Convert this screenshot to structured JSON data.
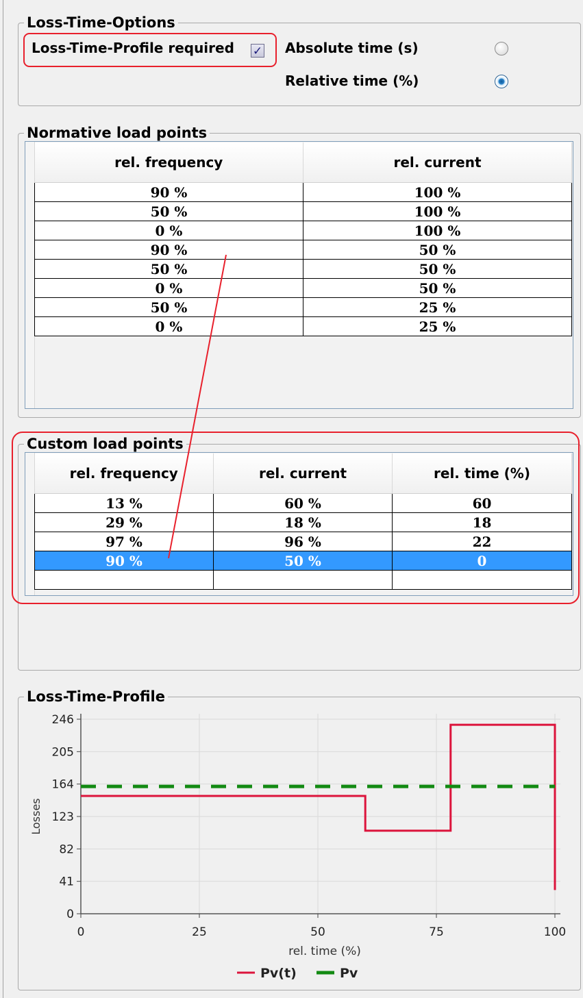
{
  "options": {
    "title": "Loss-Time-Options",
    "profile_required_label": "Loss-Time-Profile required",
    "profile_required_checked": true,
    "absolute_time_label": "Absolute time (s)",
    "relative_time_label": "Relative time (%)",
    "selected_time_mode": "relative"
  },
  "normative": {
    "title": "Normative load points",
    "columns": [
      "rel. frequency",
      "rel. current"
    ],
    "rows": [
      [
        "90 %",
        "100 %"
      ],
      [
        "50 %",
        "100 %"
      ],
      [
        "0 %",
        "100 %"
      ],
      [
        "90 %",
        "50 %"
      ],
      [
        "50 %",
        "50 %"
      ],
      [
        "0 %",
        "50 %"
      ],
      [
        "50 %",
        "25 %"
      ],
      [
        "0 %",
        "25 %"
      ]
    ]
  },
  "custom": {
    "title": "Custom load points",
    "columns": [
      "rel. frequency",
      "rel. current",
      "rel. time (%)"
    ],
    "rows": [
      [
        "13 %",
        "60 %",
        "60"
      ],
      [
        "29 %",
        "18 %",
        "18"
      ],
      [
        "97 %",
        "96 %",
        "22"
      ],
      [
        "90 %",
        "50 %",
        "0"
      ],
      [
        "",
        "",
        ""
      ]
    ],
    "selected_row": 3
  },
  "profile": {
    "title": "Loss-Time-Profile",
    "colors": {
      "pv_t": "#dc143c",
      "pv": "#138a13",
      "grid": "#d9d9d9"
    },
    "chart_data": {
      "type": "line",
      "xlabel": "rel. time (%)",
      "ylabel": "Losses",
      "xlim": [
        0,
        100
      ],
      "ylim": [
        0,
        246
      ],
      "x_ticks": [
        0,
        25,
        50,
        75,
        100
      ],
      "y_ticks": [
        0,
        41,
        82,
        123,
        164,
        205,
        246
      ],
      "grid": true,
      "legend_position": "bottom-center",
      "series": [
        {
          "name": "Pv(t)",
          "style": "solid",
          "x": [
            0,
            60,
            60,
            78,
            78,
            100,
            100
          ],
          "y": [
            149,
            149,
            105,
            105,
            239,
            239,
            30
          ]
        },
        {
          "name": "Pv",
          "style": "dashed",
          "x": [
            0,
            100
          ],
          "y": [
            161,
            161
          ]
        }
      ]
    }
  }
}
